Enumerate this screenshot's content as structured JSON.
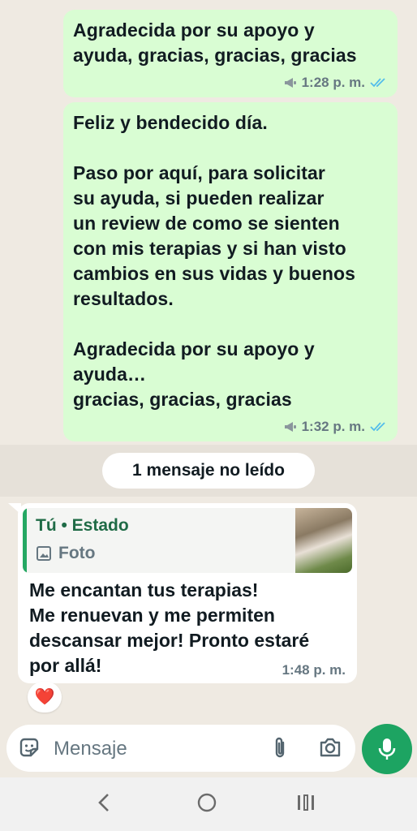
{
  "messages_out": [
    {
      "text": "Agradecida por su apoyo y\nayuda, gracias, gracias, gracias",
      "time": "1:28 p. m."
    },
    {
      "text": "Feliz y bendecido día.\n\nPaso por aquí, para solicitar\nsu ayuda, si pueden realizar\nun review de como se sienten\ncon mis terapias y si han visto\ncambios en sus vidas y buenos\nresultados.\n\nAgradecida por su apoyo y\nayuda…\ngracias, gracias, gracias",
      "time": "1:32 p. m."
    }
  ],
  "unread_divider": "1 mensaje no leído",
  "message_in": {
    "quote_author": "Tú • Estado",
    "quote_type": "Foto",
    "text": "Me encantan tus terapias!\nMe renuevan y me permiten\ndescansar mejor! Pronto estaré\npor allá!",
    "time": "1:48 p. m.",
    "reaction": "❤️"
  },
  "composer": {
    "placeholder": "Mensaje"
  },
  "icons": {
    "sticker": "sticker-icon",
    "attach": "paperclip-icon",
    "camera": "camera-icon",
    "mic": "microphone-icon",
    "broadcast": "megaphone-icon",
    "read_ticks": "double-check-icon",
    "nav_back": "chevron-left-icon",
    "nav_home": "circle-home-icon",
    "nav_recents": "recents-icon"
  },
  "colors": {
    "outgoing_bubble": "#d9fdd3",
    "chat_background": "#efeae2",
    "accent_green": "#1da462",
    "read_tick_blue": "#53bdeb"
  }
}
